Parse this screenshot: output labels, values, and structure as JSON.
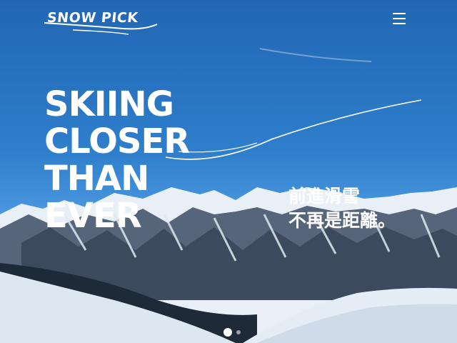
{
  "brand": {
    "logo_text": "SNOW PICK"
  },
  "header": {
    "menu_icon": "hamburger-menu-icon"
  },
  "hero": {
    "headline_lines": [
      "SKIING",
      "CLOSER",
      "THAN",
      "EVER"
    ],
    "tagline_lines": [
      "前進滑雪",
      "不再是距離。"
    ]
  },
  "carousel": {
    "slides": 2,
    "active_index": 0
  },
  "colors": {
    "sky_top": "#2166b3",
    "sky_horizon": "#a8c7e6",
    "text": "#ffffff"
  }
}
